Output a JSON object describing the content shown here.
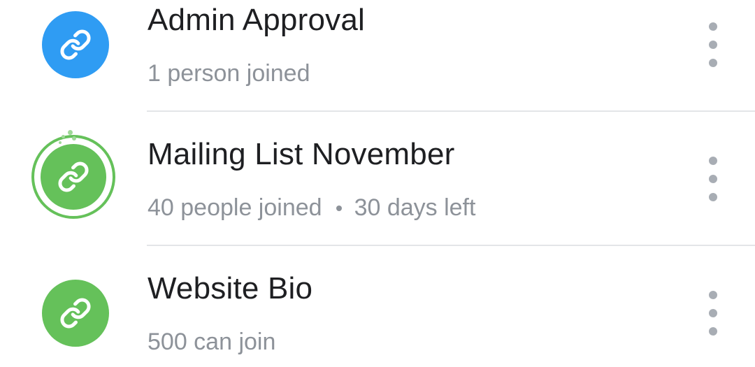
{
  "colors": {
    "blue_avatar": "#2f9cf3",
    "green_avatar": "#65c15a",
    "title_text": "#1e1f22",
    "subtitle_text": "#8d9299"
  },
  "invite_links": [
    {
      "icon": "link-icon",
      "title": "Admin Approval",
      "subtitle": "1 person joined",
      "detail": ""
    },
    {
      "icon": "link-icon",
      "title": "Mailing List November",
      "subtitle": "40 people joined",
      "detail": "30 days left"
    },
    {
      "icon": "link-icon",
      "title": "Website Bio",
      "subtitle": "500 can join",
      "detail": ""
    }
  ]
}
